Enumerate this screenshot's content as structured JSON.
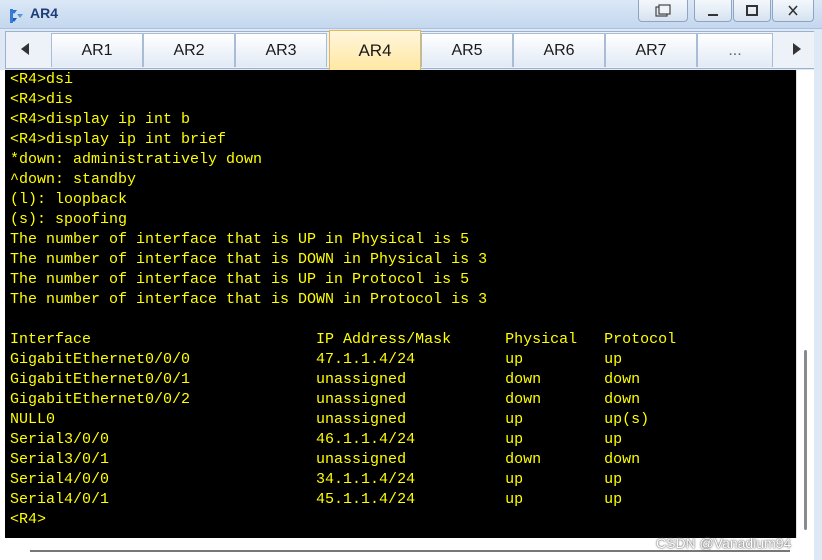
{
  "window": {
    "title": "AR4",
    "icon": "router-app-icon",
    "controls": [
      "restore-icon",
      "minimize-icon",
      "maximize-icon",
      "close-icon"
    ]
  },
  "tabs": [
    {
      "label": "AR1"
    },
    {
      "label": "AR2"
    },
    {
      "label": "AR3"
    },
    {
      "label": "AR4",
      "active": true
    },
    {
      "label": "AR5"
    },
    {
      "label": "AR6"
    },
    {
      "label": "AR7"
    },
    {
      "label": "..."
    }
  ],
  "colors": {
    "terminal_bg": "#000000",
    "terminal_text": "#ffff00",
    "active_tab": "#ffe8a3"
  },
  "terminal": {
    "lines": [
      "<R4>dsi",
      "<R4>dis",
      "<R4>display ip int b",
      "<R4>display ip int brief",
      "*down: administratively down",
      "^down: standby",
      "(l): loopback",
      "(s): spoofing",
      "The number of interface that is UP in Physical is 5",
      "The number of interface that is DOWN in Physical is 3",
      "The number of interface that is UP in Protocol is 5",
      "The number of interface that is DOWN in Protocol is 3",
      "",
      "Interface                         IP Address/Mask      Physical   Protocol",
      "GigabitEthernet0/0/0              47.1.1.4/24          up         up",
      "GigabitEthernet0/0/1              unassigned           down       down",
      "GigabitEthernet0/0/2              unassigned           down       down",
      "NULL0                             unassigned           up         up(s)",
      "Serial3/0/0                       46.1.1.4/24          up         up",
      "Serial3/0/1                       unassigned           down       down",
      "Serial4/0/0                       34.1.1.4/24          up         up",
      "Serial4/0/1                       45.1.1.4/24          up         up",
      "<R4>"
    ]
  },
  "watermark": "CSDN @Vanadium94"
}
